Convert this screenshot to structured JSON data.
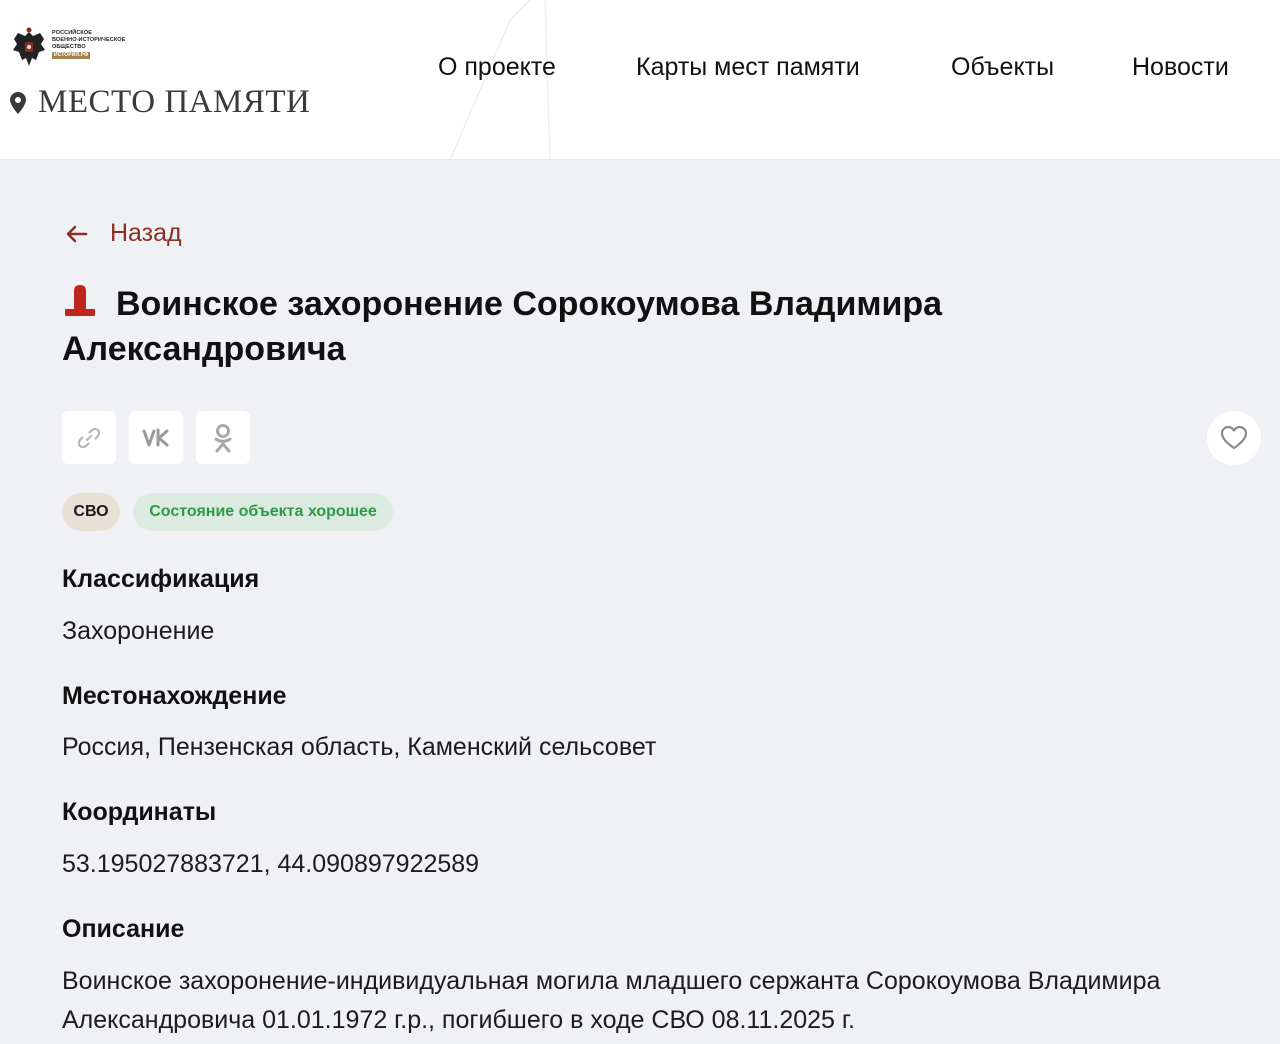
{
  "header": {
    "org_lines": [
      "Российское",
      "военно-историческое",
      "общество"
    ],
    "org_badge": "история.рф",
    "site_name": "МЕСТО ПАМЯТИ",
    "nav": [
      {
        "label": "О проекте"
      },
      {
        "label": "Карты мест памяти"
      },
      {
        "label": "Объекты"
      },
      {
        "label": "Новости"
      }
    ]
  },
  "back_label": "Назад",
  "title": "Воинское захоронение Сорокоумова Владимира Александровича",
  "share_icons": [
    "link-icon",
    "vk-icon",
    "ok-icon"
  ],
  "favorite_icon": "heart-icon",
  "badges": {
    "category": "СВО",
    "state": "Состояние объекта хорошее"
  },
  "fields": {
    "classification_label": "Классификация",
    "classification_value": "Захоронение",
    "location_label": "Местонахождение",
    "location_value": "Россия, Пензенская область, Каменский сельсовет",
    "coords_label": "Координаты",
    "coords_value": "53.195027883721, 44.090897922589",
    "description_label": "Описание",
    "description_value": "Воинское захоронение-индивидуальная могила младшего сержанта Сорокоумова Владимира Александровича 01.01.1972 г.р., погибшего в ходе СВО 08.11.2025 г."
  },
  "colors": {
    "accent": "#8a2f23",
    "icon_red": "#c0261c",
    "badge_state_text": "#2e9a45",
    "badge_state_bg": "#dcebdf",
    "badge_svo_bg": "#e8e1d6",
    "page_bg": "#f0f1f4"
  }
}
